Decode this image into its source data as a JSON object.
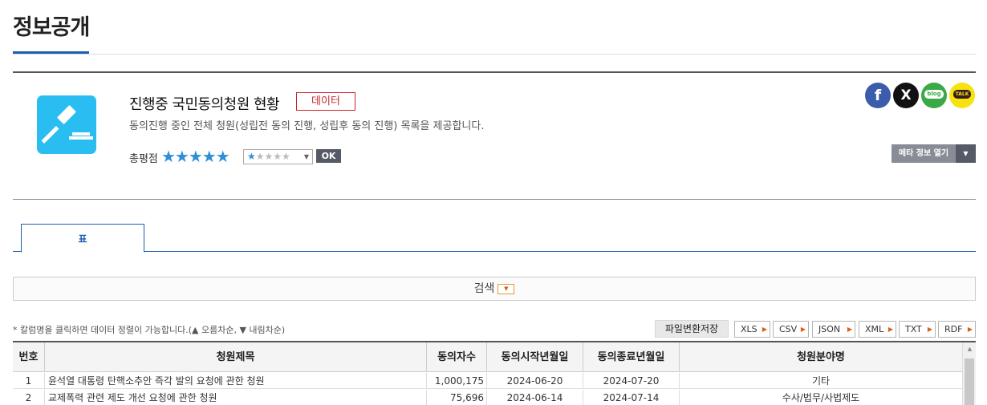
{
  "page": {
    "title": "정보공개"
  },
  "dataset": {
    "title": "진행중 국민동의청원 현황",
    "badge": "데이터",
    "description": "동의진행 중인 전체 청원(성립전 동의 진행, 성립후 동의 진행) 목록을 제공합니다.",
    "rating_label": "총평점",
    "rating_stars": "★★★★★",
    "rating": 5,
    "rating_select": {
      "filled": "★",
      "empty": "★★★★"
    },
    "ok_label": "OK",
    "icon": "gavel-icon",
    "accent": "#29bdf2"
  },
  "share": {
    "facebook": "f",
    "x": "X",
    "blog": "blog",
    "talk": "TALK"
  },
  "meta_button": {
    "label": "메타 정보 열기",
    "caret": "▼"
  },
  "tabs": [
    {
      "label": "표"
    }
  ],
  "search": {
    "label": "검색",
    "caret": "▼"
  },
  "sort_note": "* 칼럼명을 클릭하면 데이터 정렬이 가능합니다.(▲ 오름차순, ▼ 내림차순)",
  "convert": {
    "label": "파일변환저장",
    "formats": [
      "XLS",
      "CSV",
      "JSON",
      "XML",
      "TXT",
      "RDF"
    ]
  },
  "table": {
    "columns": [
      "번호",
      "청원제목",
      "동의자수",
      "동의시작년월일",
      "동의종료년월일",
      "청원분야명"
    ],
    "rows": [
      [
        "1",
        "윤석열 대통령 탄핵소추안 즉각 발의 요청에 관한 청원",
        "1,000,175",
        "2024-06-20",
        "2024-07-20",
        "기타"
      ],
      [
        "2",
        "교제폭력 관련 제도 개선 요청에 관한 청원",
        "75,696",
        "2024-06-14",
        "2024-07-14",
        "수사/법무/사법제도"
      ]
    ]
  },
  "colors": {
    "brand_blue": "#1c5fb0",
    "badge_red": "#c8262a",
    "star_blue": "#2e8fd6"
  }
}
